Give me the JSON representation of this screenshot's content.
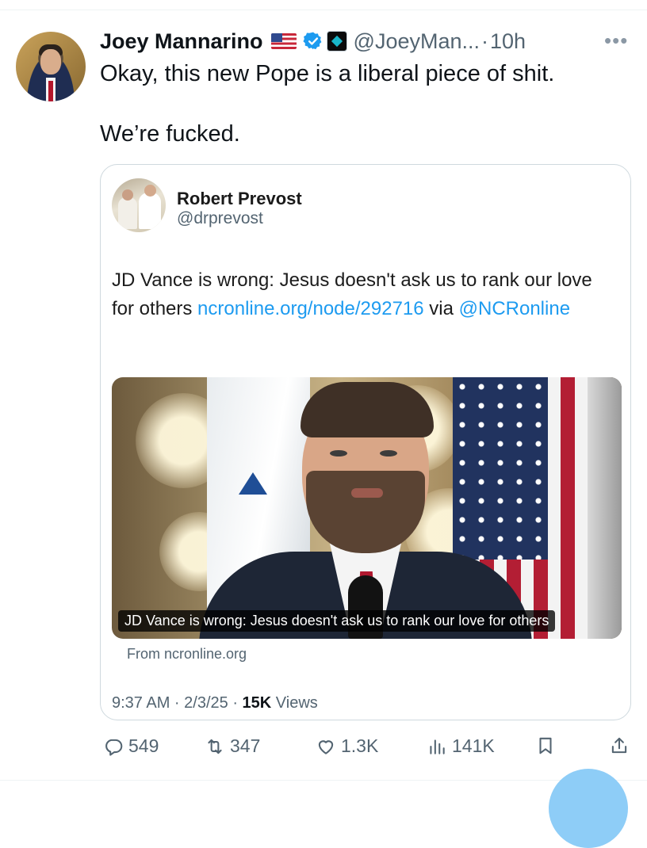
{
  "tweet": {
    "author_name": "Joey Mannarino",
    "handle": "@JoeyMan...",
    "separator": "·",
    "time": "10h",
    "more_icon": "more-horizontal-icon",
    "text_line1": "Okay, this new Pope is a liberal piece of shit.",
    "text_line2": "We’re fucked."
  },
  "quote": {
    "author_name": "Robert Prevost",
    "handle": "@drprevost",
    "text_prefix": "JD Vance is wrong: Jesus doesn't ask us to rank our love for others ",
    "link": "ncronline.org/node/292716",
    "text_mid": " via ",
    "mention": "@NCRonline",
    "media_caption": "JD Vance is wrong: Jesus doesn't ask us to rank our love for others",
    "from_text": "From ncronline.org",
    "timestamp": "9:37 AM · 2/3/25 · ",
    "views_count": "15K",
    "views_label": " Views"
  },
  "actions": {
    "replies": "549",
    "retweets": "347",
    "likes": "1.3K",
    "views": "141K"
  },
  "colors": {
    "accent": "#1d9bf0",
    "text_primary": "#0f1419",
    "text_secondary": "#536471",
    "border": "#cfd9de"
  }
}
